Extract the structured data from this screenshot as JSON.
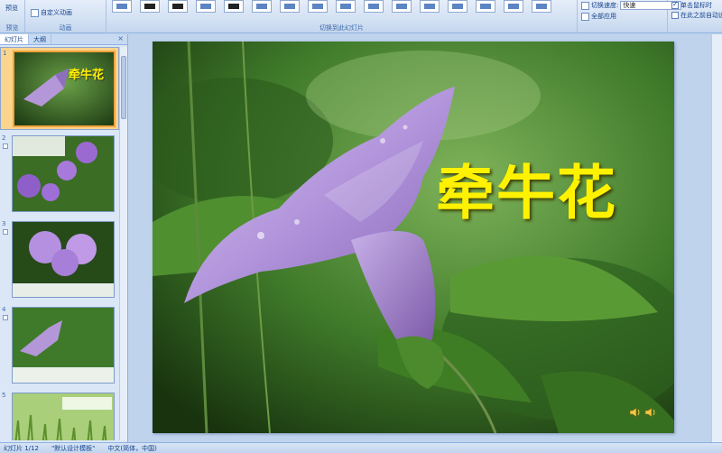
{
  "ribbon": {
    "preview_label": "预览",
    "custom_animation_label": "自定义动画",
    "group_preview": "预览",
    "group_animation": "动画",
    "group_transition": "切换到此幻灯片",
    "speed_label": "切换速度:",
    "speed_value": "快速",
    "apply_all_label": "全部应用",
    "on_click_label": "单击鼠标时",
    "after_label": "在此之前自动设"
  },
  "left_panel": {
    "tab_slides": "幻灯片",
    "tab_outline": "大纲",
    "close": "×",
    "slides": [
      {
        "num": "1",
        "title": "牵牛花"
      },
      {
        "num": "2"
      },
      {
        "num": "3"
      },
      {
        "num": "4"
      },
      {
        "num": "5"
      }
    ]
  },
  "slide": {
    "title": "牵牛花"
  },
  "status": {
    "slide_count": "幻灯片 1/12",
    "theme": "\"默认设计模板\"",
    "language": "中文(简体，中国)"
  },
  "colors": {
    "title": "#fff200",
    "ribbon_bg": "#d3e1f3",
    "selected_thumb": "#f3a33b"
  }
}
